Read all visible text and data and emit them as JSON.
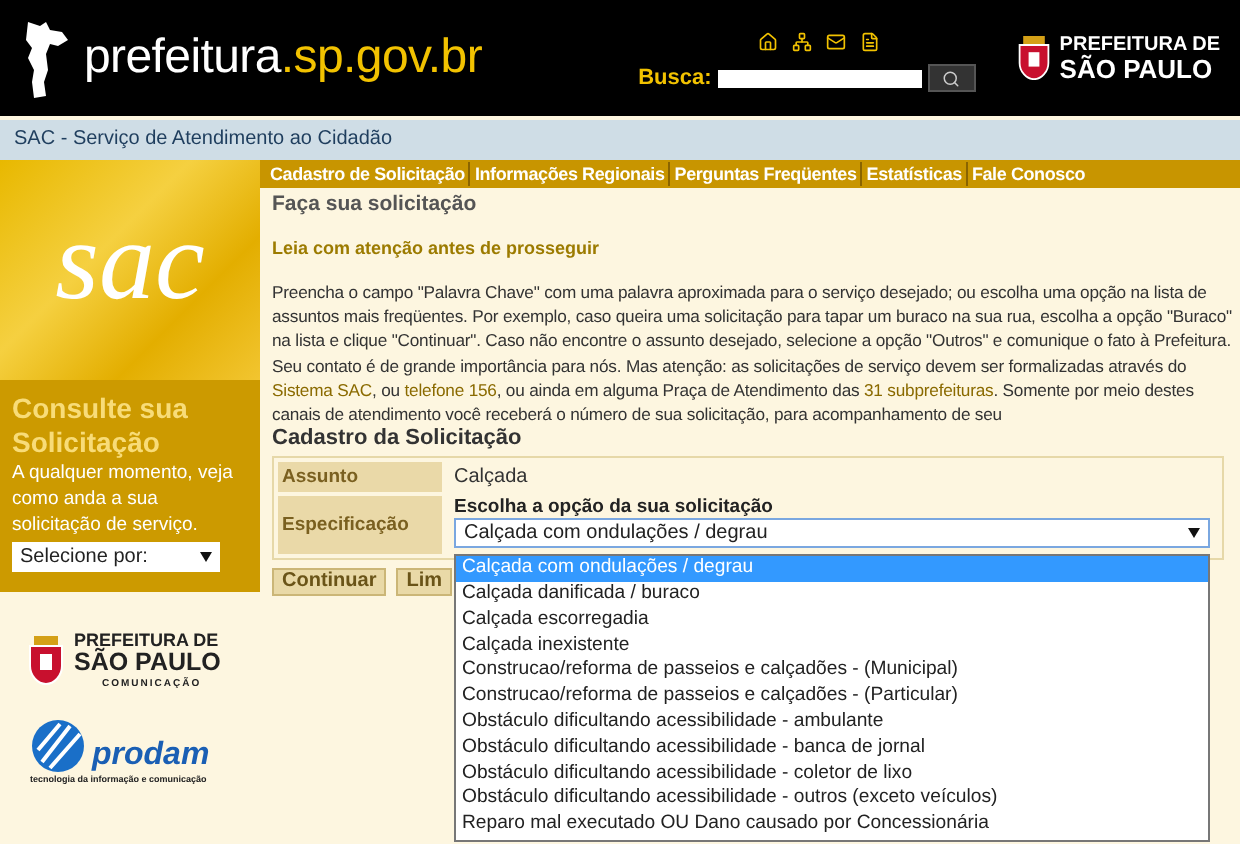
{
  "header": {
    "site_name": "prefeitura",
    "site_domain": ".sp.gov.br",
    "search_label": "Busca:",
    "city_logo_line1": "PREFEITURA DE",
    "city_logo_line2": "SÃO PAULO"
  },
  "breadcrumb": "SAC - Serviço de Atendimento ao Cidadão",
  "nav": [
    "Cadastro de Solicitação",
    "Informações Regionais",
    "Perguntas Freqüentes",
    "Estatísticas",
    "Fale Conosco"
  ],
  "sidebar": {
    "logo": "sac",
    "consult_title": "Consulte sua Solicitação",
    "consult_text": "A qualquer momento, veja como anda a sua solicitação de serviço.",
    "consult_select": "Selecione por:",
    "comm_logo_line1": "PREFEITURA DE",
    "comm_logo_line2": "SÃO PAULO",
    "comm_logo_line3": "COMUNICAÇÃO",
    "prodam_name": "prodam",
    "prodam_tagline": "tecnologia da informação e comunicação"
  },
  "page_title": "Faça sua solicitação",
  "notice": "Leia com atenção antes de prosseguir",
  "intro": [
    {
      "text": "Preencha o campo \"Palavra Chave\" com uma palavra aproximada para o serviço desejado; ou escolha uma opção na lista de assuntos mais freqüentes. Por exemplo, caso queira uma solicitação para tapar um buraco na sua rua, escolha a opção \"Buraco\" na lista e clique \"Continuar\". Caso não encontre o assunto desejado, selecione a opção \"Outros\" e comunique o fato à Prefeitura. Seu contato é de grande importância para nós. Mas atenção: as solicitações de serviço devem ser formalizadas através do ",
      "link": false
    },
    {
      "text": "Sistema SAC",
      "link": true
    },
    {
      "text": ", ou ",
      "link": false
    },
    {
      "text": "telefone 156",
      "link": true
    },
    {
      "text": ", ou ainda em alguma Praça de Atendimento das ",
      "link": false
    },
    {
      "text": "31 subprefeituras",
      "link": true
    },
    {
      "text": ". Somente por meio destes canais de atendimento você receberá o número de sua solicitação, para acompanhamento de seu",
      "link": false
    }
  ],
  "form": {
    "title": "Cadastro da Solicitação",
    "rows": [
      {
        "label": "Assunto",
        "kind": "text",
        "value": "Calçada"
      },
      {
        "label": "Especificação",
        "kind": "select",
        "prompt": "Escolha a opção da sua solicitação",
        "value": "Calçada com ondulações / degrau",
        "expanded": true
      }
    ],
    "buttons": [
      "Continuar",
      "Lim"
    ]
  },
  "options": [
    {
      "label": "Calçada com ondulações / degrau",
      "selected": true
    },
    {
      "label": "Calçada danificada / buraco",
      "selected": false
    },
    {
      "label": "Calçada escorregadia",
      "selected": false
    },
    {
      "label": "Calçada inexistente",
      "selected": false
    },
    {
      "label": "Construcao/reforma de passeios e calçadões - (Municipal)",
      "selected": false
    },
    {
      "label": "Construcao/reforma de passeios e calçadões - (Particular)",
      "selected": false
    },
    {
      "label": "Obstáculo dificultando acessibilidade - ambulante",
      "selected": false
    },
    {
      "label": "Obstáculo dificultando acessibilidade - banca de jornal",
      "selected": false
    },
    {
      "label": "Obstáculo dificultando acessibilidade - coletor de lixo",
      "selected": false
    },
    {
      "label": "Obstáculo dificultando acessibilidade - outros (exceto veículos)",
      "selected": false
    },
    {
      "label": "Reparo mal executado OU Dano causado por Concessionária",
      "selected": false
    }
  ]
}
